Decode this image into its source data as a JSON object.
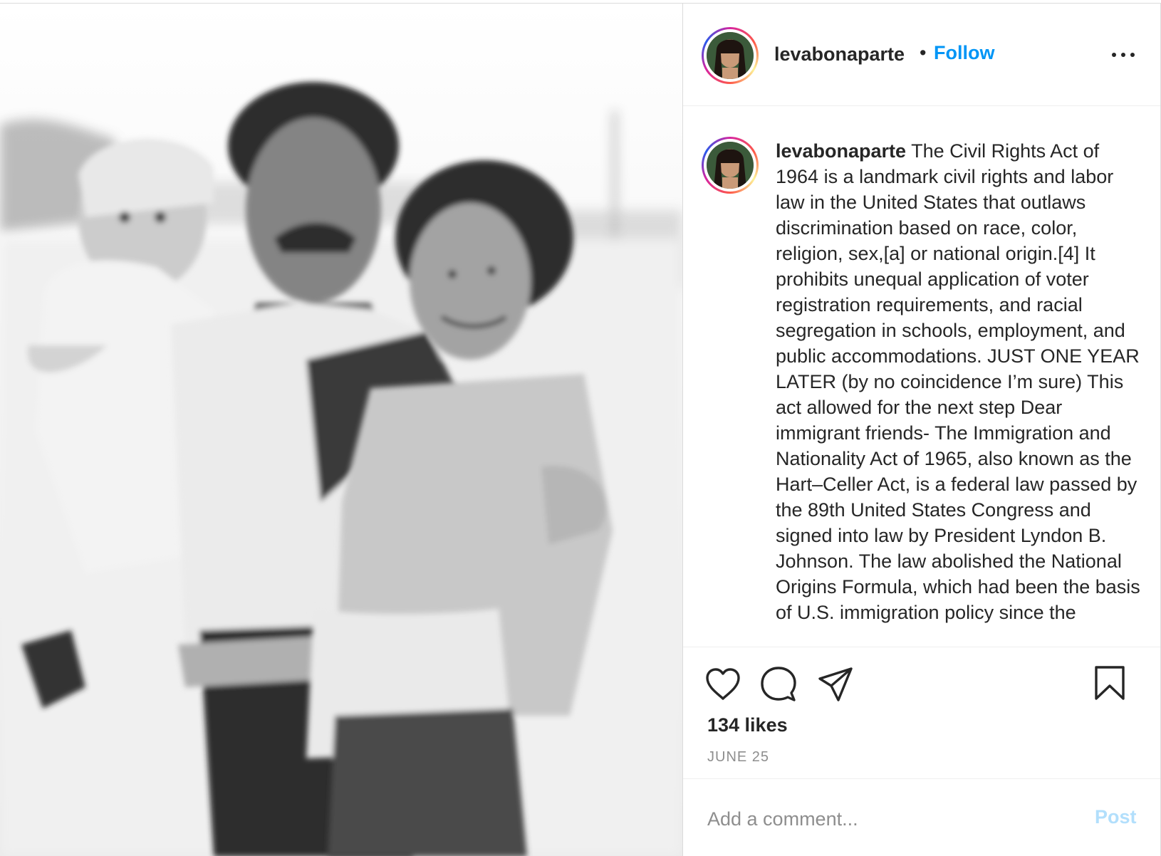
{
  "post": {
    "username": "levabonaparte",
    "separator": "•",
    "follow_label": "Follow",
    "caption": "The Civil Rights Act of 1964 is a landmark civil rights and labor law in the United States that outlaws discrimination based on race, color, religion, sex,[a] or national origin.[4] It prohibits unequal application of voter registration requirements, and racial segregation in schools, employment, and public accommodations. JUST ONE YEAR LATER (by no coincidence I’m sure) This act allowed for the next step Dear immigrant friends- The Immigration and Nationality Act of 1965, also known as the Hart–Celler Act, is a federal law passed by the 89th United States Congress and signed into law by President Lyndon B. Johnson. The law abolished the National Origins Formula, which had been the basis of U.S. immigration policy since the",
    "likes": "134 likes",
    "date": "JUNE 25"
  },
  "comment": {
    "placeholder": "Add a comment...",
    "post_label": "Post"
  },
  "icons": {
    "more": "more-options-icon",
    "like": "heart-icon",
    "comment": "comment-bubble-icon",
    "share": "paper-plane-icon",
    "save": "bookmark-icon"
  },
  "colors": {
    "link_blue": "#0095f6",
    "post_disabled": "#b2dffc",
    "muted": "#8e8e8e",
    "text": "#262626"
  }
}
